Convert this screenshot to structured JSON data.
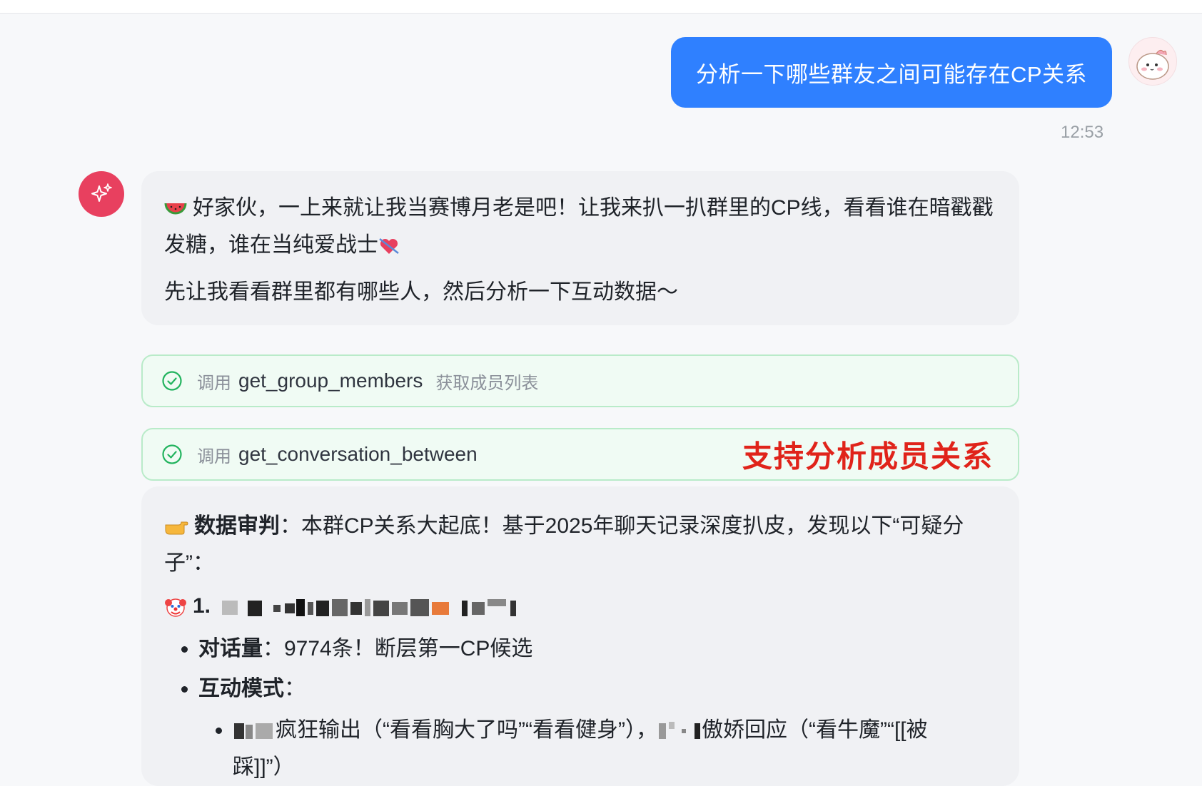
{
  "user_message": {
    "text": "分析一下哪些群友之间可能存在CP关系",
    "time": "12:53"
  },
  "assistant_intro": {
    "line1": "好家伙，一上来就让我当赛博月老是吧！让我来扒一扒群里的CP线，看看谁在暗戳戳发糖，谁在当纯爱战士",
    "line2": "先让我看看群里都有哪些人，然后分析一下互动数据～"
  },
  "tool_calls": [
    {
      "call_label": "调用",
      "function": "get_group_members",
      "description": "获取成员列表"
    },
    {
      "call_label": "调用",
      "function": "get_conversation_between",
      "description": ""
    }
  ],
  "annotation": "支持分析成员关系",
  "analysis": {
    "heading_bold": "数据审判",
    "heading_rest": "：本群CP关系大起底！基于2025年聊天记录深度扒皮，发现以下“可疑分子”：",
    "item_number": "1.",
    "bullet1_bold": "对话量",
    "bullet1_rest": "：9774条！断层第一CP候选",
    "bullet2_bold": "互动模式",
    "bullet2_rest": "：",
    "sub1_a": "疯狂输出（“看看胸大了吗”“看看健身”），",
    "sub1_b": "傲娇回应（“看牛魔”“[[被",
    "sub1_c": "踩]]”）"
  },
  "colors": {
    "user_bubble": "#2f80ff",
    "ai_avatar": "#e8405f",
    "tool_border": "#b9ebc9",
    "annotation": "#e0231a"
  }
}
